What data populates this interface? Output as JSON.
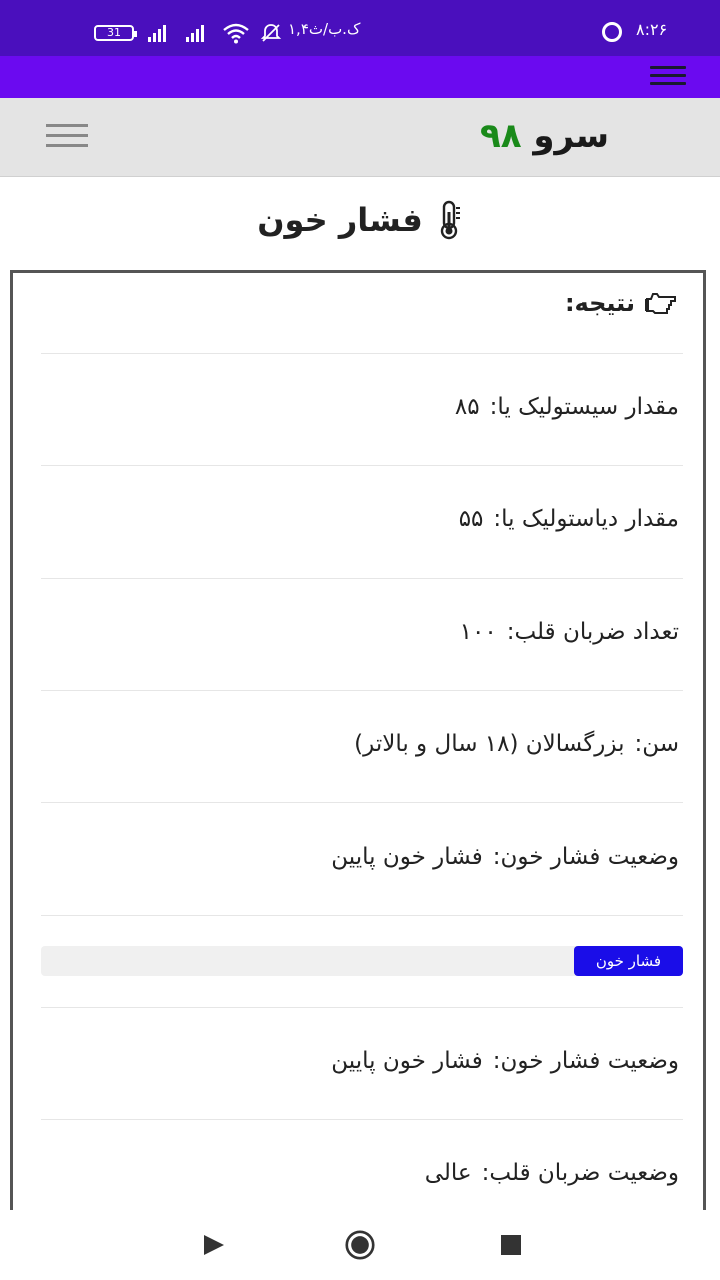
{
  "status_bar": {
    "time": "۸:۲۶",
    "data_speed": "۱,۴ک.ب/ث",
    "battery": "31"
  },
  "header": {
    "logo_name": "سرو",
    "logo_number": "۹۸"
  },
  "page": {
    "title": "فشار خون",
    "title_icon": "thermometer-icon"
  },
  "result": {
    "heading": "نتیجه:",
    "heading_icon": "hand-pointing-icon",
    "rows": [
      {
        "label": "مقدار سیستولیک یا:",
        "value": "۸۵"
      },
      {
        "label": "مقدار دیاستولیک یا:",
        "value": "۵۵"
      },
      {
        "label": "تعداد ضربان قلب:",
        "value": "۱۰۰"
      },
      {
        "label": "سن:",
        "value": "بزرگسالان (۱۸ سال و بالاتر)"
      },
      {
        "label": "وضعیت فشار خون:",
        "value": "فشار خون پایین"
      }
    ],
    "progress": {
      "label": "فشار خون",
      "percent": 17,
      "color": "#1a0de8"
    },
    "rows_after": [
      {
        "label": "وضعیت فشار خون:",
        "value": "فشار خون پایین"
      },
      {
        "label": "وضعیت ضربان قلب:",
        "value": "عالی"
      }
    ]
  },
  "colors": {
    "status_bar": "#4a0fbd",
    "app_bar": "#6b0af0",
    "logo_accent": "#1a8a1a"
  },
  "nav": {
    "back_icon": "back-triangle-icon",
    "home_icon": "home-circle-icon",
    "recents_icon": "recents-square-icon"
  }
}
